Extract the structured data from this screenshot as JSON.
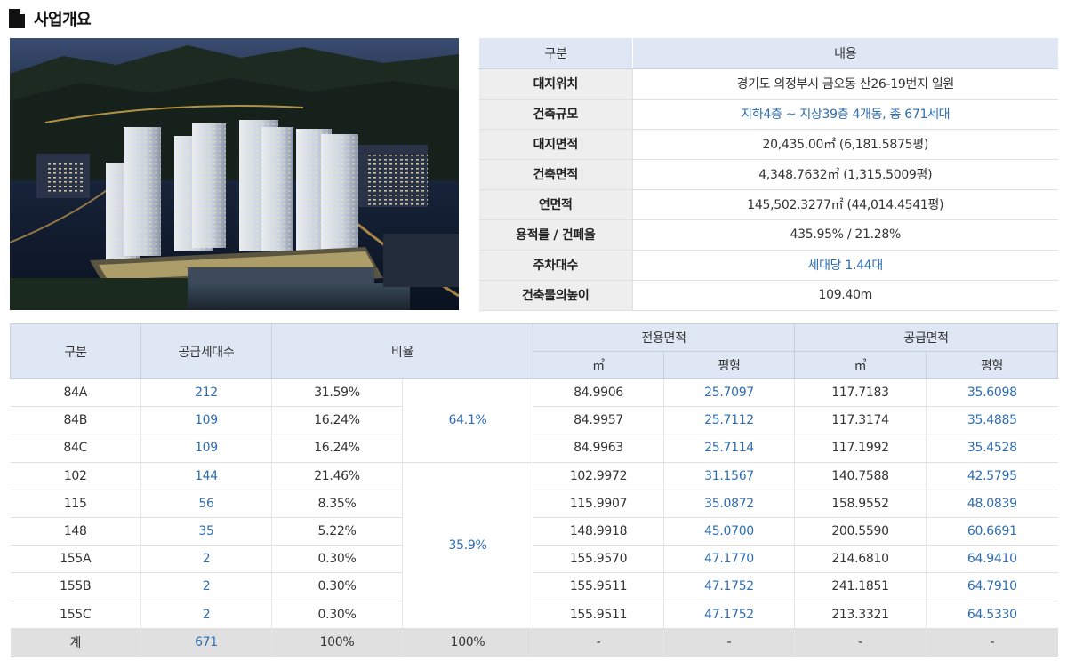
{
  "page": {
    "title": "사업개요"
  },
  "info_table": {
    "headers": [
      "구분",
      "내용"
    ],
    "rows": [
      {
        "label": "대지위치",
        "value": "경기도 의정부시 금오동 산26-19번지 일원",
        "highlight": false
      },
      {
        "label": "건축규모",
        "value": "지하4층 ~ 지상39층 4개동, 총 671세대",
        "highlight": true
      },
      {
        "label": "대지면적",
        "value": "20,435.00㎡ (6,181.5875평)",
        "highlight": false
      },
      {
        "label": "건축면적",
        "value": "4,348.7632㎡ (1,315.5009평)",
        "highlight": false
      },
      {
        "label": "연면적",
        "value": "145,502.3277㎡ (44,014.4541평)",
        "highlight": false
      },
      {
        "label": "용적률 / 건폐율",
        "value": "435.95% / 21.28%",
        "highlight": false
      },
      {
        "label": "주차대수",
        "value": "세대당 1.44대",
        "highlight": true
      },
      {
        "label": "건축물의높이",
        "value": "109.40m",
        "highlight": false
      }
    ]
  },
  "unit_table": {
    "headers": {
      "type": "구분",
      "households": "공급세대수",
      "ratio": "비율",
      "exclusive_area": "전용면적",
      "supply_area": "공급면적",
      "sqm": "㎡",
      "pyeong": "평형"
    },
    "group_ratios": [
      "64.1%",
      "35.9%"
    ],
    "rows": [
      {
        "type": "84A",
        "households": "212",
        "ratio": "31.59%",
        "ex_sqm": "84.9906",
        "ex_py": "25.7097",
        "su_sqm": "117.7183",
        "su_py": "35.6098"
      },
      {
        "type": "84B",
        "households": "109",
        "ratio": "16.24%",
        "ex_sqm": "84.9957",
        "ex_py": "25.7112",
        "su_sqm": "117.3174",
        "su_py": "35.4885"
      },
      {
        "type": "84C",
        "households": "109",
        "ratio": "16.24%",
        "ex_sqm": "84.9963",
        "ex_py": "25.7114",
        "su_sqm": "117.1992",
        "su_py": "35.4528"
      },
      {
        "type": "102",
        "households": "144",
        "ratio": "21.46%",
        "ex_sqm": "102.9972",
        "ex_py": "31.1567",
        "su_sqm": "140.7588",
        "su_py": "42.5795"
      },
      {
        "type": "115",
        "households": "56",
        "ratio": "8.35%",
        "ex_sqm": "115.9907",
        "ex_py": "35.0872",
        "su_sqm": "158.9552",
        "su_py": "48.0839"
      },
      {
        "type": "148",
        "households": "35",
        "ratio": "5.22%",
        "ex_sqm": "148.9918",
        "ex_py": "45.0700",
        "su_sqm": "200.5590",
        "su_py": "60.6691"
      },
      {
        "type": "155A",
        "households": "2",
        "ratio": "0.30%",
        "ex_sqm": "155.9570",
        "ex_py": "47.1770",
        "su_sqm": "214.6810",
        "su_py": "64.9410"
      },
      {
        "type": "155B",
        "households": "2",
        "ratio": "0.30%",
        "ex_sqm": "155.9511",
        "ex_py": "47.1752",
        "su_sqm": "241.1851",
        "su_py": "64.7910"
      },
      {
        "type": "155C",
        "households": "2",
        "ratio": "0.30%",
        "ex_sqm": "155.9511",
        "ex_py": "47.1752",
        "su_sqm": "213.3321",
        "su_py": "64.5330"
      }
    ],
    "total": {
      "type": "계",
      "households": "671",
      "ratio": "100%",
      "group_ratio": "100%",
      "ex_sqm": "-",
      "ex_py": "-",
      "su_sqm": "-",
      "su_py": "-"
    }
  },
  "colors": {
    "accent_blue": "#2e6db3",
    "header_bg": "#dfe7f5",
    "label_bg": "#eeeeee",
    "total_bg": "#e0e0e0"
  },
  "icons": {
    "title_icon": "document-icon"
  }
}
